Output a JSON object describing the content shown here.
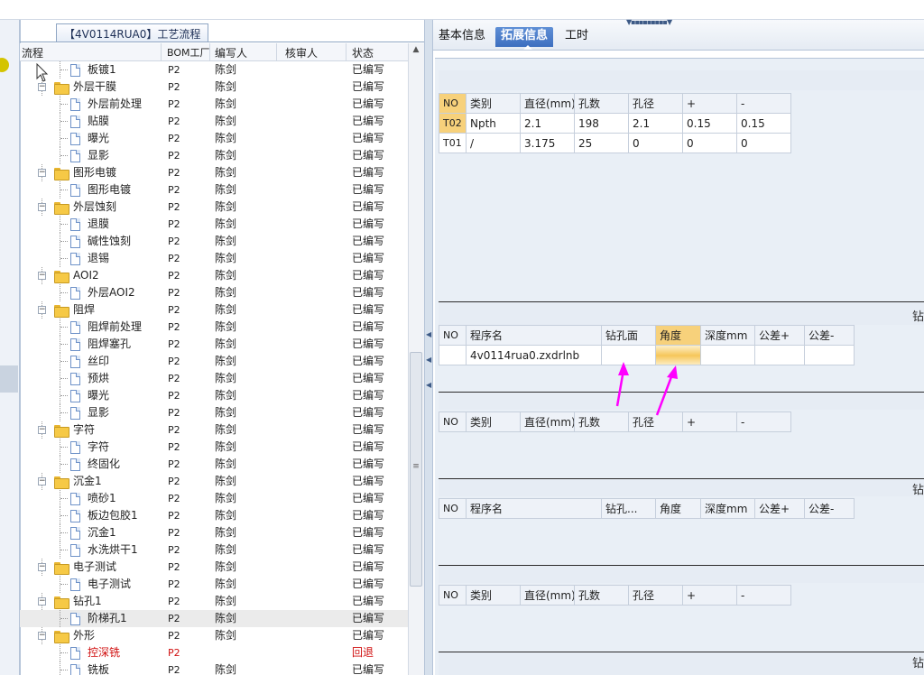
{
  "tree": {
    "title": "【4V0114RUA0】工艺流程",
    "columns": [
      "流程",
      "BOM工厂",
      "编写人",
      "核审人",
      "状态"
    ],
    "rows": [
      {
        "level": 2,
        "type": "doc",
        "name": "板镀1",
        "plant": "P2",
        "writer": "陈剑",
        "status": "已编写"
      },
      {
        "level": 1,
        "type": "folder",
        "name": "外层干膜",
        "plant": "P2",
        "writer": "陈剑",
        "status": "已编写"
      },
      {
        "level": 2,
        "type": "doc",
        "name": "外层前处理",
        "plant": "P2",
        "writer": "陈剑",
        "status": "已编写"
      },
      {
        "level": 2,
        "type": "doc",
        "name": "贴膜",
        "plant": "P2",
        "writer": "陈剑",
        "status": "已编写"
      },
      {
        "level": 2,
        "type": "doc",
        "name": "曝光",
        "plant": "P2",
        "writer": "陈剑",
        "status": "已编写"
      },
      {
        "level": 2,
        "type": "doc",
        "name": "显影",
        "plant": "P2",
        "writer": "陈剑",
        "status": "已编写"
      },
      {
        "level": 1,
        "type": "folder",
        "name": "图形电镀",
        "plant": "P2",
        "writer": "陈剑",
        "status": "已编写"
      },
      {
        "level": 2,
        "type": "doc",
        "name": "图形电镀",
        "plant": "P2",
        "writer": "陈剑",
        "status": "已编写"
      },
      {
        "level": 1,
        "type": "folder",
        "name": "外层蚀刻",
        "plant": "P2",
        "writer": "陈剑",
        "status": "已编写"
      },
      {
        "level": 2,
        "type": "doc",
        "name": "退膜",
        "plant": "P2",
        "writer": "陈剑",
        "status": "已编写"
      },
      {
        "level": 2,
        "type": "doc",
        "name": "碱性蚀刻",
        "plant": "P2",
        "writer": "陈剑",
        "status": "已编写"
      },
      {
        "level": 2,
        "type": "doc",
        "name": "退锡",
        "plant": "P2",
        "writer": "陈剑",
        "status": "已编写"
      },
      {
        "level": 1,
        "type": "folder",
        "name": "AOI2",
        "plant": "P2",
        "writer": "陈剑",
        "status": "已编写"
      },
      {
        "level": 2,
        "type": "doc",
        "name": "外层AOI2",
        "plant": "P2",
        "writer": "陈剑",
        "status": "已编写"
      },
      {
        "level": 1,
        "type": "folder",
        "name": "阻焊",
        "plant": "P2",
        "writer": "陈剑",
        "status": "已编写"
      },
      {
        "level": 2,
        "type": "doc",
        "name": "阻焊前处理",
        "plant": "P2",
        "writer": "陈剑",
        "status": "已编写"
      },
      {
        "level": 2,
        "type": "doc",
        "name": "阻焊塞孔",
        "plant": "P2",
        "writer": "陈剑",
        "status": "已编写"
      },
      {
        "level": 2,
        "type": "doc",
        "name": "丝印",
        "plant": "P2",
        "writer": "陈剑",
        "status": "已编写"
      },
      {
        "level": 2,
        "type": "doc",
        "name": "预烘",
        "plant": "P2",
        "writer": "陈剑",
        "status": "已编写"
      },
      {
        "level": 2,
        "type": "doc",
        "name": "曝光",
        "plant": "P2",
        "writer": "陈剑",
        "status": "已编写"
      },
      {
        "level": 2,
        "type": "doc",
        "name": "显影",
        "plant": "P2",
        "writer": "陈剑",
        "status": "已编写"
      },
      {
        "level": 1,
        "type": "folder",
        "name": "字符",
        "plant": "P2",
        "writer": "陈剑",
        "status": "已编写"
      },
      {
        "level": 2,
        "type": "doc",
        "name": "字符",
        "plant": "P2",
        "writer": "陈剑",
        "status": "已编写"
      },
      {
        "level": 2,
        "type": "doc",
        "name": "终固化",
        "plant": "P2",
        "writer": "陈剑",
        "status": "已编写"
      },
      {
        "level": 1,
        "type": "folder",
        "name": "沉金1",
        "plant": "P2",
        "writer": "陈剑",
        "status": "已编写"
      },
      {
        "level": 2,
        "type": "doc",
        "name": "喷砂1",
        "plant": "P2",
        "writer": "陈剑",
        "status": "已编写"
      },
      {
        "level": 2,
        "type": "doc",
        "name": "板边包胶1",
        "plant": "P2",
        "writer": "陈剑",
        "status": "已编写"
      },
      {
        "level": 2,
        "type": "doc",
        "name": "沉金1",
        "plant": "P2",
        "writer": "陈剑",
        "status": "已编写"
      },
      {
        "level": 2,
        "type": "doc",
        "name": "水洗烘干1",
        "plant": "P2",
        "writer": "陈剑",
        "status": "已编写"
      },
      {
        "level": 1,
        "type": "folder",
        "name": "电子测试",
        "plant": "P2",
        "writer": "陈剑",
        "status": "已编写"
      },
      {
        "level": 2,
        "type": "doc",
        "name": "电子测试",
        "plant": "P2",
        "writer": "陈剑",
        "status": "已编写"
      },
      {
        "level": 1,
        "type": "folder",
        "name": "钻孔1",
        "plant": "P2",
        "writer": "陈剑",
        "status": "已编写"
      },
      {
        "level": 2,
        "type": "doc",
        "name": "阶梯孔1",
        "plant": "P2",
        "writer": "陈剑",
        "status": "已编写",
        "selected": true
      },
      {
        "level": 1,
        "type": "folder",
        "name": "外形",
        "plant": "P2",
        "writer": "陈剑",
        "status": "已编写"
      },
      {
        "level": 2,
        "type": "doc",
        "name": "控深铣",
        "plant": "P2",
        "writer": "",
        "status": "回退",
        "red": true
      },
      {
        "level": 2,
        "type": "doc",
        "name": "铣板",
        "plant": "P2",
        "writer": "陈剑",
        "status": "已编写"
      }
    ]
  },
  "tabs": {
    "basic": "基本信息",
    "extended": "拓展信息",
    "hours": "工时"
  },
  "section_header_label": "钻",
  "drill_table": {
    "headers": [
      "NO",
      "类别",
      "直径(mm)",
      "孔数",
      "孔径",
      "+",
      "-"
    ],
    "rows": [
      [
        "T02",
        "Npth",
        "2.1",
        "198",
        "2.1",
        "0.15",
        "0.15"
      ],
      [
        "T01",
        "/",
        "3.175",
        "25",
        "0",
        "0",
        "0"
      ]
    ]
  },
  "program_table_1": {
    "headers": [
      "NO",
      "程序名",
      "钻孔面",
      "角度",
      "深度mm",
      "公差+",
      "公差-"
    ],
    "rows": [
      [
        "",
        "4v0114rua0.zxdrlnb",
        "",
        "",
        "",
        "",
        ""
      ]
    ]
  },
  "drill_table_2": {
    "headers": [
      "NO",
      "类别",
      "直径(mm)",
      "孔数",
      "孔径",
      "+",
      "-"
    ]
  },
  "program_table_2": {
    "headers": [
      "NO",
      "程序名",
      "钻孔...",
      "角度",
      "深度mm",
      "公差+",
      "公差-"
    ]
  },
  "drill_table_3": {
    "headers": [
      "NO",
      "类别",
      "直径(mm)",
      "孔数",
      "孔径",
      "+",
      "-"
    ]
  },
  "colors": {
    "accent_tab": "#3d6fbf",
    "highlight": "#f7d17b",
    "arrow": "#ff00ff",
    "status_red": "#d01010"
  }
}
